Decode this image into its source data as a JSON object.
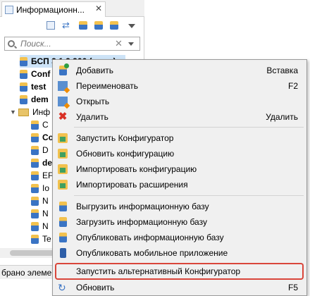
{
  "panel": {
    "tab_title": "Информационн...",
    "search_placeholder": "Поиск...",
    "status_text": "брано элемен"
  },
  "tree": {
    "items": [
      {
        "text": "БСП 3.1.2.366 (демо)",
        "bold": true,
        "selected": true
      },
      {
        "text": "Conf",
        "bold": true
      },
      {
        "text": "test",
        "bold": true
      },
      {
        "text": "dem",
        "bold": true
      },
      {
        "text": "Инф"
      },
      {
        "text": "C"
      },
      {
        "text": "Co",
        "bold": true
      },
      {
        "text": "D"
      },
      {
        "text": "de",
        "bold": true
      },
      {
        "text": "EF"
      },
      {
        "text": "Io"
      },
      {
        "text": "N"
      },
      {
        "text": "N"
      },
      {
        "text": "N"
      },
      {
        "text": "Te"
      }
    ]
  },
  "context_menu": {
    "items": [
      {
        "label": "Добавить",
        "shortcut": "Вставка",
        "icon": "add-database-icon"
      },
      {
        "label": "Переименовать",
        "shortcut": "F2",
        "icon": "rename-icon"
      },
      {
        "label": "Открыть",
        "shortcut": "",
        "icon": "open-icon"
      },
      {
        "label": "Удалить",
        "shortcut": "Удалить",
        "icon": "delete-icon"
      },
      {
        "label": "Запустить Конфигуратор",
        "shortcut": "",
        "icon": "configurator-icon"
      },
      {
        "label": "Обновить конфигурацию",
        "shortcut": "",
        "icon": "update-config-icon"
      },
      {
        "label": "Импортировать конфигурацию",
        "shortcut": "",
        "icon": "import-config-icon"
      },
      {
        "label": "Импортировать расширения",
        "shortcut": "",
        "icon": "import-extensions-icon"
      },
      {
        "label": "Выгрузить информационную базу",
        "shortcut": "",
        "icon": "export-infobase-icon"
      },
      {
        "label": "Загрузить информационную базу",
        "shortcut": "",
        "icon": "load-infobase-icon"
      },
      {
        "label": "Опубликовать информационную базу",
        "shortcut": "",
        "icon": "publish-infobase-icon"
      },
      {
        "label": "Опубликовать мобильное приложение",
        "shortcut": "",
        "icon": "mobile-app-icon"
      },
      {
        "label": "Запустить альтернативный Конфигуратор",
        "shortcut": "",
        "icon": "",
        "highlighted": true
      },
      {
        "label": "Обновить",
        "shortcut": "F5",
        "icon": "refresh-icon"
      }
    ]
  },
  "colors": {
    "menu_background": "#f0f0f0",
    "highlight_border": "#d9463b",
    "selection": "#cde3f7"
  }
}
